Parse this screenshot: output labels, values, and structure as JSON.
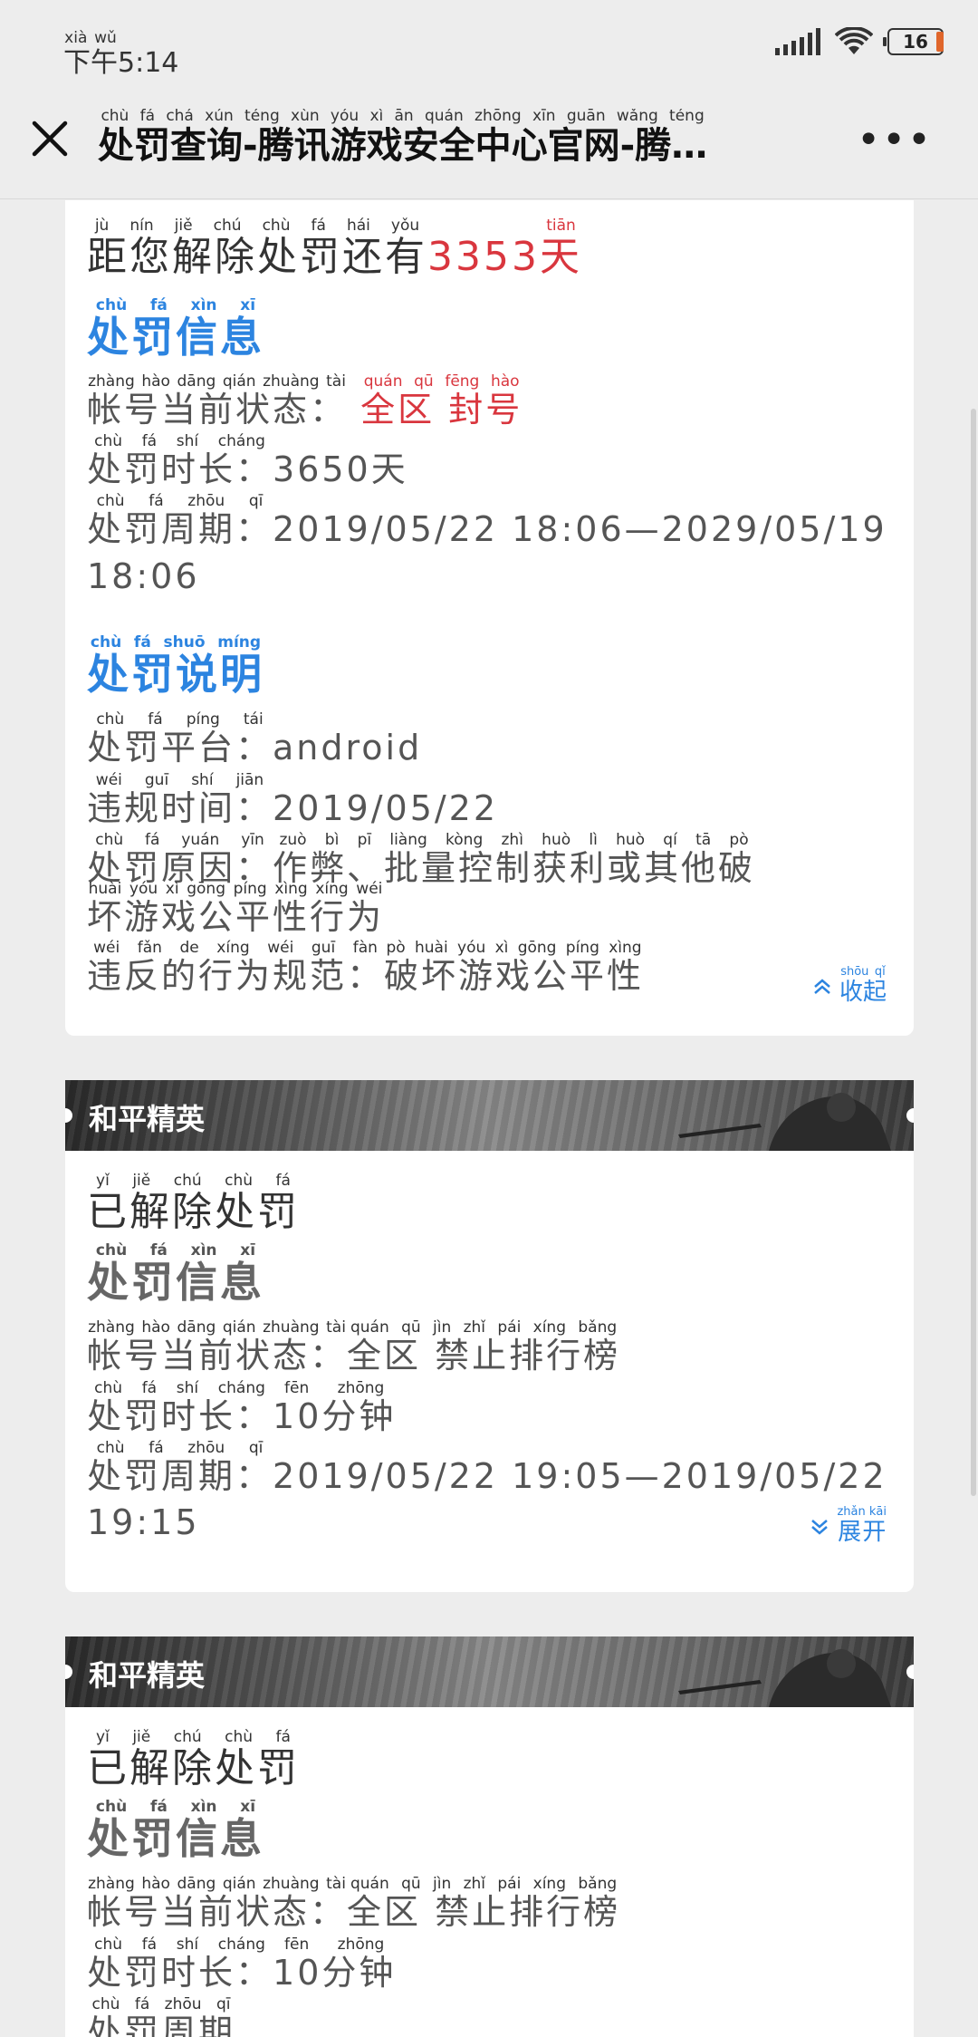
{
  "status_bar": {
    "time_prefix": "下午",
    "time_prefix_pinyin": [
      "xià",
      "wǔ"
    ],
    "time": "5:14",
    "battery": "16"
  },
  "nav": {
    "title": "处罚查询-腾讯游戏安全中心官网-腾…",
    "title_pinyin": "chù fá chá xún  téng xùn yóu xì ān quán zhōng xīn guān wǎng  téng"
  },
  "card1": {
    "countdown_prefix": "距您解除处罚还有",
    "countdown_value": "3353",
    "countdown_unit": "天",
    "info_heading": "处罚信息",
    "status_label": "帐号当前状态：",
    "status_value": "全区  封号",
    "duration_label": "处罚时长：",
    "duration_value": "3650天",
    "period_label": "处罚周期：",
    "period_value_1": "2019/05/22 18:06—2029/05/19",
    "period_value_2": "18:06",
    "desc_heading": "处罚说明",
    "platform_label": "处罚平台：",
    "platform_value": "android",
    "violation_time_label": "违规时间：",
    "violation_time_value": "2019/05/22",
    "reason_label": "处罚原因：",
    "reason_value_1": "作弊、批量控制获利或其他破",
    "reason_value_2": "坏游戏公平性行为",
    "rule_label": "违反的行为规范：",
    "rule_value": "破坏游戏公平性",
    "collapse_label": "收起"
  },
  "card2": {
    "game_name": "和平精英",
    "state": "已解除处罚",
    "info_heading": "处罚信息",
    "status_label": "帐号当前状态：",
    "status_value": "全区  禁止排行榜",
    "duration_label": "处罚时长：",
    "duration_value": "10分钟",
    "period_label": "处罚周期：",
    "period_value_1": "2019/05/22 19:05—2019/05/22",
    "period_value_2": "19:15",
    "expand_label": "展开"
  },
  "card3": {
    "game_name": "和平精英",
    "state": "已解除处罚",
    "info_heading": "处罚信息",
    "status_label": "帐号当前状态：",
    "status_value": "全区  禁止排行榜",
    "duration_label": "处罚时长：",
    "duration_value": "10分钟",
    "period_label_partial": "处罚周期"
  },
  "colors": {
    "accent_blue": "#2c84e0",
    "alert_red": "#d9363e",
    "page_bg": "#ededed"
  },
  "icons": [
    "close-icon",
    "more-icon",
    "signal-icon",
    "wifi-icon",
    "battery-icon",
    "chevron-up-double-icon",
    "chevron-down-double-icon"
  ]
}
